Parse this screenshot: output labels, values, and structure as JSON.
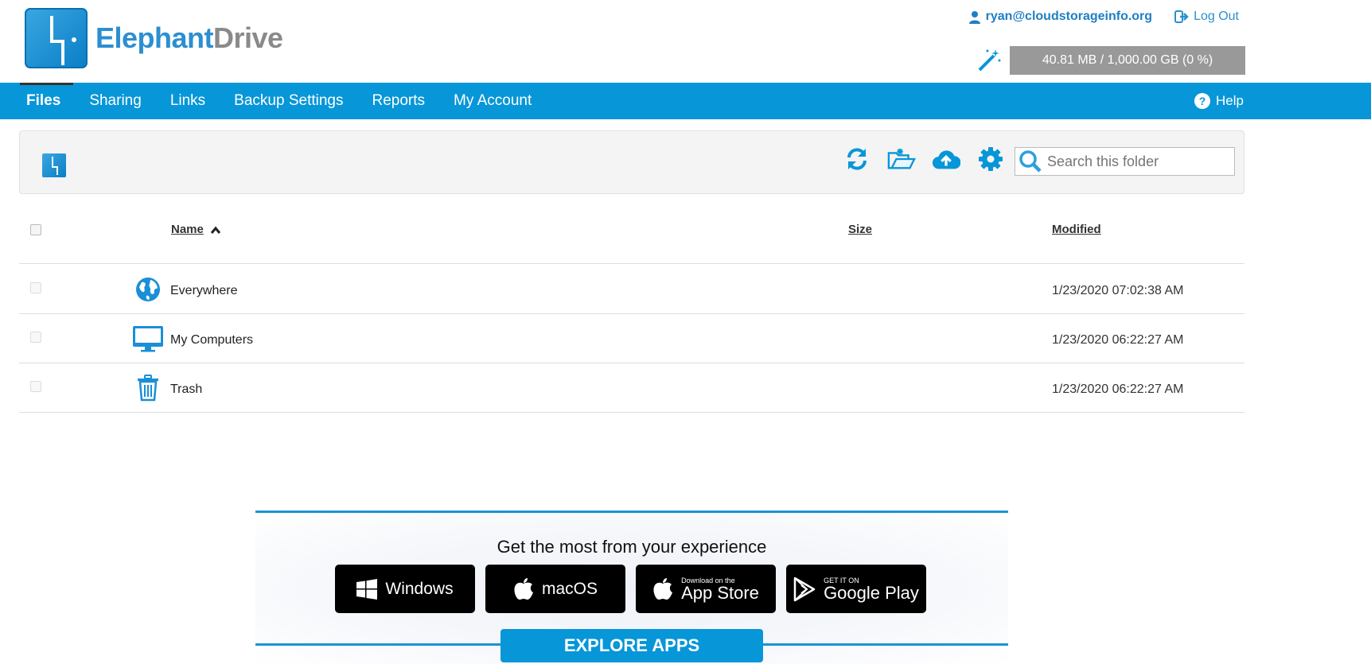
{
  "brand": {
    "part1": "Elephant",
    "part2": "Drive"
  },
  "user": {
    "email": "ryan@cloudstorageinfo.org",
    "logout_label": "Log Out"
  },
  "storage": {
    "usage_text": "40.81 MB / 1,000.00 GB (0 %)",
    "percent": 0
  },
  "nav": {
    "items": [
      {
        "label": "Files"
      },
      {
        "label": "Sharing"
      },
      {
        "label": "Links"
      },
      {
        "label": "Backup Settings"
      },
      {
        "label": "Reports"
      },
      {
        "label": "My Account"
      }
    ],
    "help_label": "Help"
  },
  "toolbar": {
    "icons": [
      "refresh-icon",
      "new-folder-icon",
      "upload-icon",
      "gear-icon"
    ],
    "search_placeholder": "Search this folder"
  },
  "table": {
    "headers": {
      "name": "Name",
      "size": "Size",
      "modified": "Modified"
    },
    "sort": "name-ascending",
    "rows": [
      {
        "name": "Everywhere",
        "size": "",
        "modified": "1/23/2020 07:02:38 AM",
        "icon": "globe-icon"
      },
      {
        "name": "My Computers",
        "size": "",
        "modified": "1/23/2020 06:22:27 AM",
        "icon": "monitor-icon"
      },
      {
        "name": "Trash",
        "size": "",
        "modified": "1/23/2020 06:22:27 AM",
        "icon": "trash-icon"
      }
    ]
  },
  "promo": {
    "title": "Get the most from your experience",
    "windows_label": "Windows",
    "macos_label": "macOS",
    "appstore_small": "Download on the",
    "appstore_big": "App Store",
    "googleplay_small": "GET IT ON",
    "googleplay_big": "Google Play",
    "explore_label": "EXPLORE APPS"
  },
  "colors": {
    "accent": "#0796d8",
    "storage_bar": "#999999"
  }
}
